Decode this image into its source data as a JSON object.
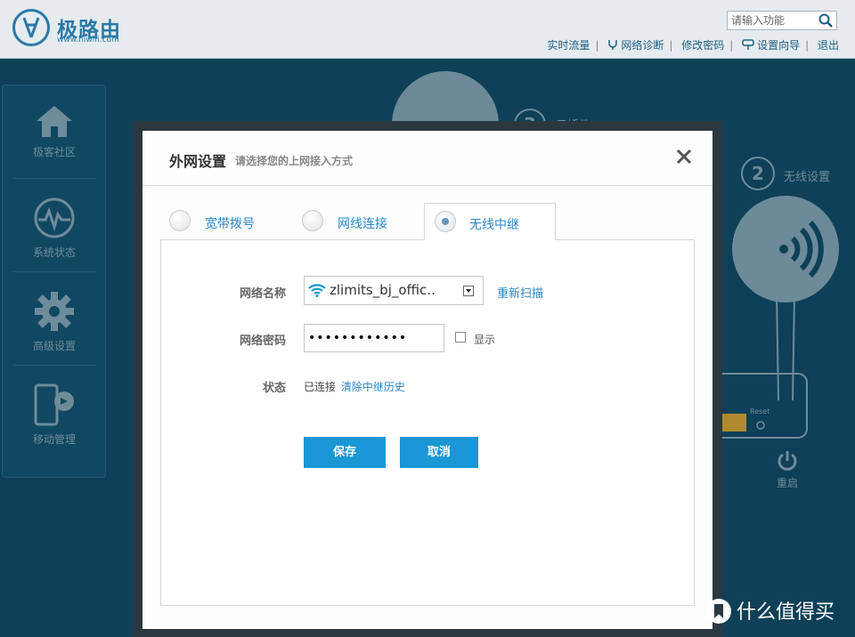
{
  "header": {
    "logo_text": "极路由",
    "logo_url": "www.hiwifi.com",
    "search_placeholder": "请输入功能",
    "links": [
      "实时流量",
      "网络诊断",
      "修改密码",
      "设置向导",
      "退出"
    ]
  },
  "sidebar": {
    "items": [
      {
        "label": "极客社区",
        "icon": "home-icon"
      },
      {
        "label": "系统状态",
        "icon": "pulse-icon"
      },
      {
        "label": "高级设置",
        "icon": "gear-icon"
      },
      {
        "label": "移动管理",
        "icon": "mobile-icon"
      }
    ]
  },
  "background": {
    "step3_label": "云插件",
    "step2_label": "无线设置",
    "step2_num": "2",
    "step3_num": "3",
    "reset_label": "Reset",
    "reboot_label": "重启"
  },
  "modal": {
    "title": "外网设置",
    "subtitle": "请选择您的上网接入方式",
    "tabs": [
      {
        "label": "宽带拨号",
        "selected": false
      },
      {
        "label": "网线连接",
        "selected": false
      },
      {
        "label": "无线中继",
        "selected": true
      }
    ],
    "form": {
      "ssid_label": "网络名称",
      "ssid_value": "zlimits_bj_offic..",
      "rescan_label": "重新扫描",
      "password_label": "网络密码",
      "password_value": "wirelesspass",
      "show_label": "显示",
      "status_label": "状态",
      "status_value": "已连接",
      "clear_history_label": "清除中继历史"
    },
    "buttons": {
      "save": "保存",
      "cancel": "取消"
    }
  },
  "watermark": {
    "text": "什么值得买"
  },
  "colors": {
    "accent": "#1a97d5",
    "link": "#2a86c6",
    "bg": "#0e4057",
    "header": "#e6ebee"
  }
}
